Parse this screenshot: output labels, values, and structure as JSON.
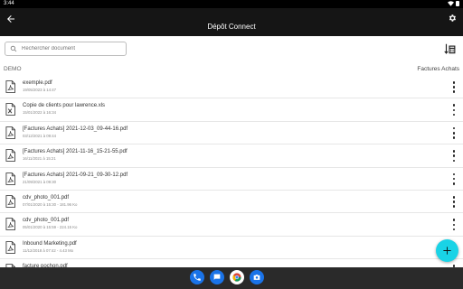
{
  "status_bar": {
    "time": "3:44"
  },
  "app_bar": {
    "title": "Dépôt Connect"
  },
  "search": {
    "placeholder": "Rechercher document"
  },
  "breadcrumb": {
    "left": "DEMO",
    "right": "Factures Achats"
  },
  "files": [
    {
      "name": "exemple.pdf",
      "meta": "19/05/2023 à 14:47",
      "type": "pdf"
    },
    {
      "name": "Copie de clients pour lawrence.xls",
      "meta": "15/01/2022 à 16:34",
      "type": "xls"
    },
    {
      "name": "[Factures Achats] 2021-12-03_09-44-16.pdf",
      "meta": "03/12/2021 à 09:44",
      "type": "pdf"
    },
    {
      "name": "[Factures Achats] 2021-11-16_15-21-55.pdf",
      "meta": "16/11/2021 à 15:21",
      "type": "pdf"
    },
    {
      "name": "[Factures Achats] 2021-09-21_09-30-12.pdf",
      "meta": "21/09/2021 à 09:30",
      "type": "pdf"
    },
    {
      "name": "cdv_photo_001.pdf",
      "meta": "07/01/2020 à 15:30 - 181.96 Ko",
      "type": "pdf"
    },
    {
      "name": "cdv_photo_001.pdf",
      "meta": "05/01/2020 à 15:59 - 224.15 Ko",
      "type": "pdf"
    },
    {
      "name": "Inbound Marketing.pdf",
      "meta": "11/12/2018 à 07:42 - 4.43 Mo",
      "type": "pdf"
    },
    {
      "name": "facture pochon.pdf",
      "meta": "",
      "type": "pdf"
    }
  ],
  "colors": {
    "appbar": "#151515",
    "fab": "#19d3e6",
    "taskbar": "#2a2a2a"
  },
  "icons": {
    "back": "arrow-left-icon",
    "settings": "gear-icon",
    "search": "search-icon",
    "sort": "sort-calendar-icon",
    "more": "more-vert-icon",
    "fab": "plus-icon"
  },
  "taskbar": {
    "apps": [
      "phone",
      "messages",
      "chrome",
      "camera"
    ]
  }
}
